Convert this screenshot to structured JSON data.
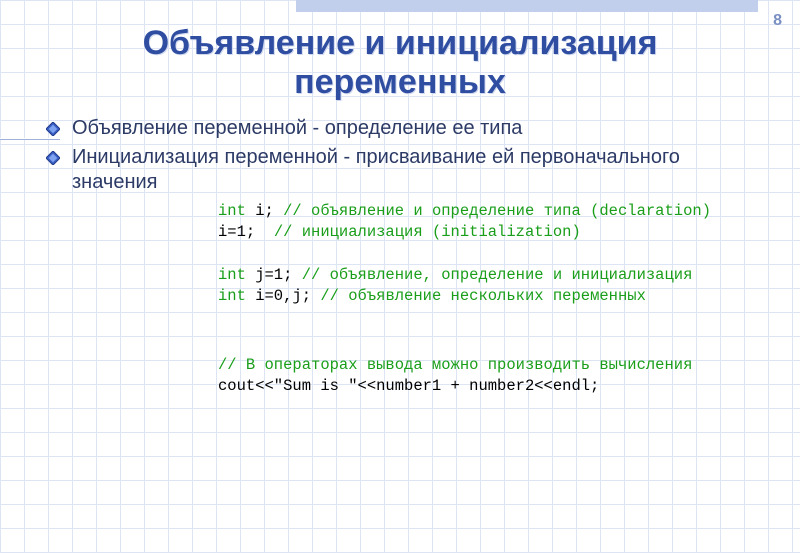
{
  "page_number": "8",
  "title_line1": "Объявление и инициализация",
  "title_line2": "переменных",
  "bullets": [
    "Объявление переменной - определение ее типа",
    "Инициализация переменной - присваивание ей первоначального значения"
  ],
  "code": {
    "l1_kw": "int",
    "l1_code": " i; ",
    "l1_cm": "// объявление и определение типа (declaration)",
    "l2_code": "i=1;  ",
    "l2_cm": "// инициализация (initialization)",
    "l3_kw": "int",
    "l3_code": " j=1; ",
    "l3_cm": "// объявление, определение и инициализация",
    "l4_kw": "int",
    "l4_code": " i=0,j; ",
    "l4_cm": "// объявление нескольких переменных",
    "l5_cm": "// В операторах вывода можно производить вычисления",
    "l6_code": "cout<<\"Sum is \"<<number1 + number2<<endl;"
  }
}
